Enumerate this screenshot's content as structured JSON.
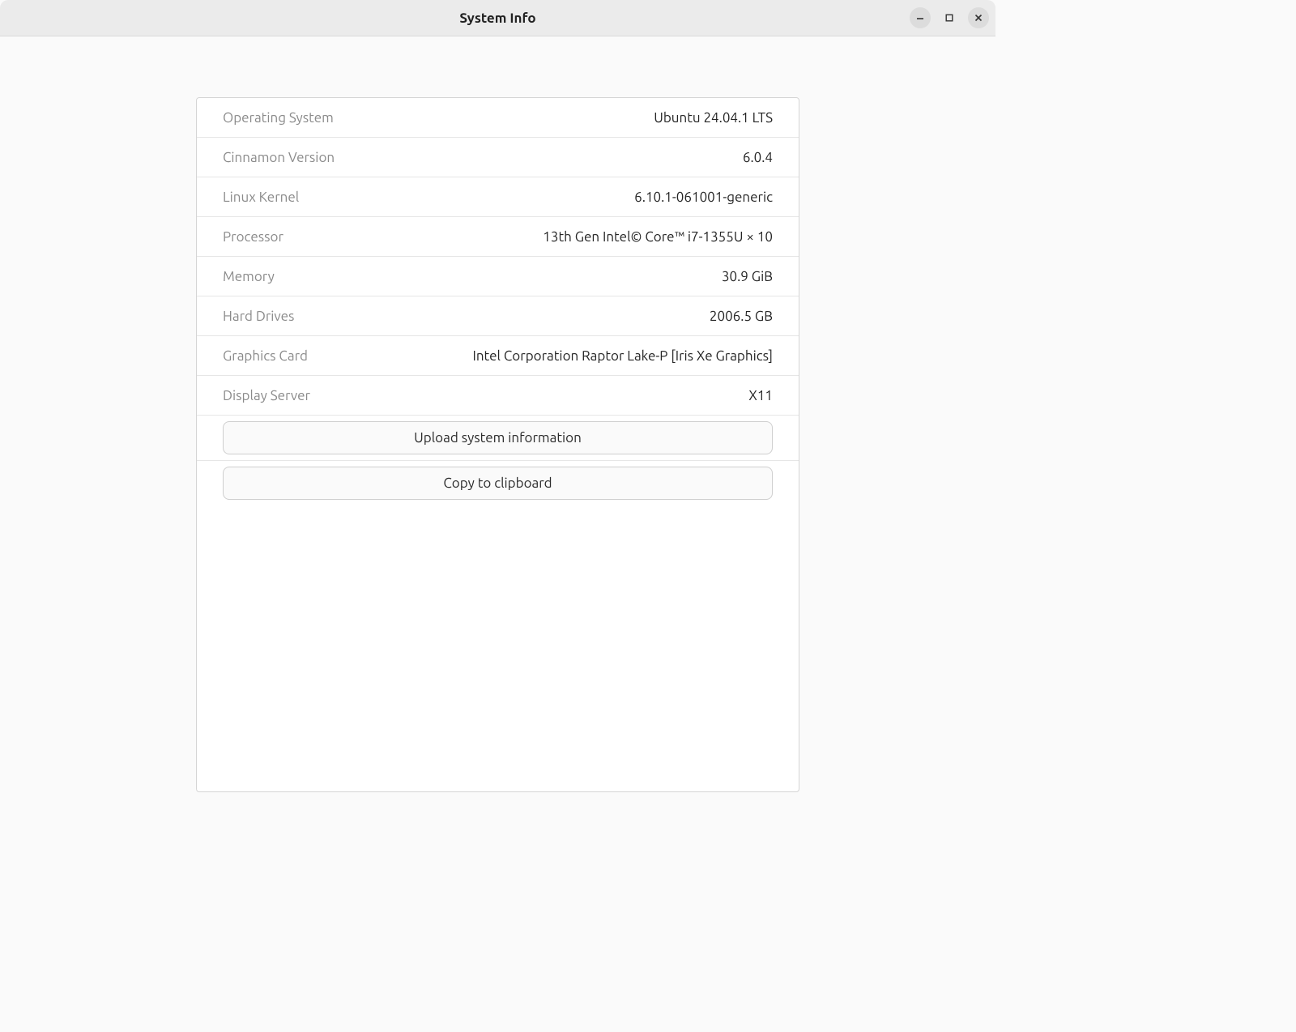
{
  "header": {
    "title": "System Info"
  },
  "rows": [
    {
      "label": "Operating System",
      "value": "Ubuntu 24.04.1 LTS"
    },
    {
      "label": "Cinnamon Version",
      "value": "6.0.4"
    },
    {
      "label": "Linux Kernel",
      "value": "6.10.1-061001-generic"
    },
    {
      "label": "Processor",
      "value": "13th Gen Intel© Core™ i7-1355U × 10"
    },
    {
      "label": "Memory",
      "value": "30.9 GiB"
    },
    {
      "label": "Hard Drives",
      "value": "2006.5 GB"
    },
    {
      "label": "Graphics Card",
      "value": "Intel Corporation Raptor Lake-P [Iris Xe Graphics]"
    },
    {
      "label": "Display Server",
      "value": "X11"
    }
  ],
  "buttons": {
    "upload": "Upload system information",
    "copy": "Copy to clipboard"
  }
}
